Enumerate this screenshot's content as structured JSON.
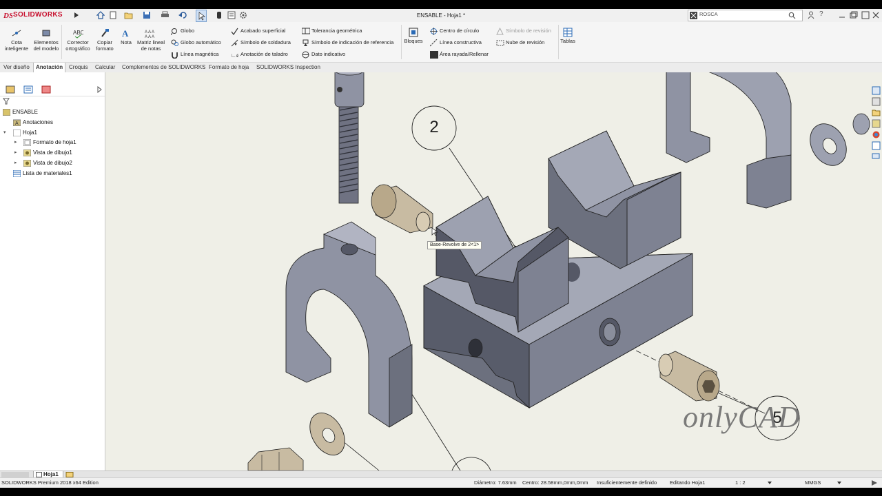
{
  "app": {
    "logo_text": "SOLIDWORKS",
    "window_title": "ENSABLE - Hoja1 *",
    "search_value": "ROSCA"
  },
  "ribbon": {
    "cota_inteligente": "Cota inteligente",
    "elementos_del_modelo": "Elementos del modelo",
    "corrector_ortografico": "Corrector ortográfico",
    "copiar_formato": "Copiar formato",
    "nota": "Nota",
    "matriz_lineal_notas": "Matriz lineal de notas",
    "globo": "Globo",
    "globo_automatico": "Globo automático",
    "linea_magnetica": "Línea magnética",
    "acabado_superficial": "Acabado superficial",
    "simbolo_soldadura": "Símbolo de soldadura",
    "anotacion_taladro": "Anotación de taladro",
    "tolerancia_geometrica": "Tolerancia geométrica",
    "simbolo_indicacion_referencia": "Símbolo de indicación de referencia",
    "dato_indicativo": "Dato indicativo",
    "bloques": "Bloques",
    "centro_circulo": "Centro de círculo",
    "linea_constructiva": "Línea constructiva",
    "area_rayada": "Área rayada/Rellenar",
    "simbolo_revision": "Símbolo de revisión",
    "nube_revision": "Nube de revisión",
    "tablas": "Tablas"
  },
  "tabs": [
    {
      "label": "Ver diseño"
    },
    {
      "label": "Anotación"
    },
    {
      "label": "Croquis"
    },
    {
      "label": "Calcular"
    },
    {
      "label": "Complementos de SOLIDWORKS"
    },
    {
      "label": "Formato de hoja"
    },
    {
      "label": "SOLIDWORKS Inspection"
    }
  ],
  "tree": {
    "root": "ENSABLE",
    "anotaciones": "Anotaciones",
    "hoja": "Hoja1",
    "formato_hoja": "Formato de hoja1",
    "vista1": "Vista de dibujo1",
    "vista2": "Vista de dibujo2",
    "lista_materiales": "Lista de materiales1"
  },
  "canvas": {
    "balloon1": "2",
    "balloon2": "5",
    "tooltip": "Base-Revolve de 2<1>",
    "watermark": "onlyCAD"
  },
  "sheet_tab": "Hoja1",
  "status": {
    "edition": "SOLIDWORKS Premium 2018 x64 Edition",
    "diameter": "Diámetro: 7.63mm",
    "center": "Centro: 28.58mm,0mm,0mm",
    "definition": "Insuficientemente definido",
    "editing": "Editando Hoja1",
    "scale": "1 : 2",
    "units": "MMGS"
  },
  "colors": {
    "part_fill": "#8f93a3",
    "part_dark": "#5e6270",
    "part_top": "#b1b4c2",
    "bolt_fill": "#c8bba2",
    "canvas_bg": "#efefe7",
    "brand_red": "#c8102e"
  }
}
